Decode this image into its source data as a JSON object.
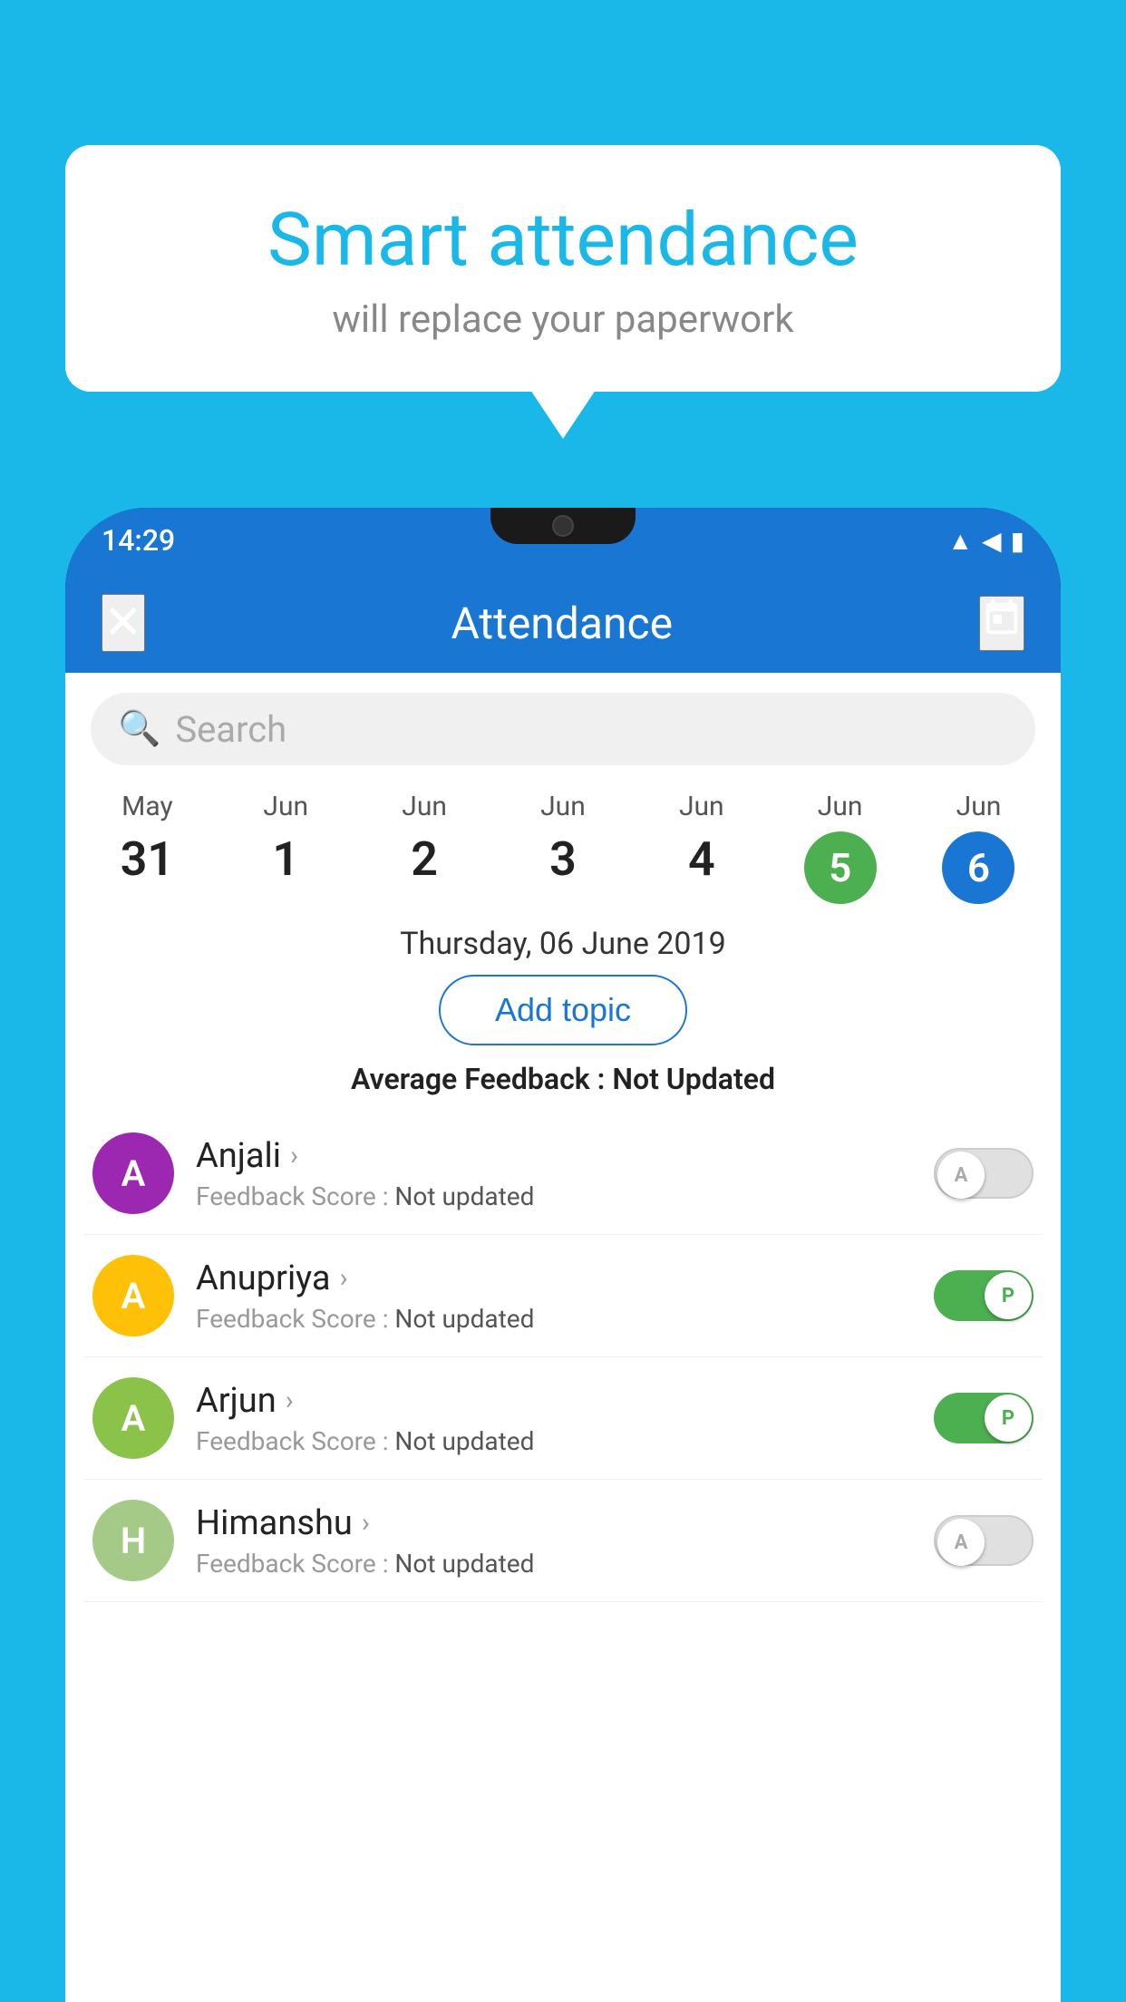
{
  "background_color": "#1ab8e8",
  "bubble": {
    "title": "Smart attendance",
    "subtitle": "will replace your paperwork"
  },
  "status_bar": {
    "time": "14:29",
    "wifi_icon": "▲",
    "signal_icon": "▲",
    "battery_icon": "▮"
  },
  "app_bar": {
    "title": "Attendance",
    "close_label": "×",
    "calendar_icon": "📅"
  },
  "search": {
    "placeholder": "Search"
  },
  "calendar": {
    "days": [
      {
        "month": "May",
        "date": "31",
        "state": "normal"
      },
      {
        "month": "Jun",
        "date": "1",
        "state": "normal"
      },
      {
        "month": "Jun",
        "date": "2",
        "state": "normal"
      },
      {
        "month": "Jun",
        "date": "3",
        "state": "normal"
      },
      {
        "month": "Jun",
        "date": "4",
        "state": "normal"
      },
      {
        "month": "Jun",
        "date": "5",
        "state": "today"
      },
      {
        "month": "Jun",
        "date": "6",
        "state": "selected"
      }
    ]
  },
  "selected_date": "Thursday, 06 June 2019",
  "add_topic_label": "Add topic",
  "avg_feedback_label": "Average Feedback : ",
  "avg_feedback_value": "Not Updated",
  "students": [
    {
      "name": "Anjali",
      "avatar_letter": "A",
      "avatar_color": "#9c27b0",
      "feedback_label": "Feedback Score : ",
      "feedback_value": "Not updated",
      "toggle_state": "off",
      "toggle_letter": "A"
    },
    {
      "name": "Anupriya",
      "avatar_letter": "A",
      "avatar_color": "#ffc107",
      "feedback_label": "Feedback Score : ",
      "feedback_value": "Not updated",
      "toggle_state": "on",
      "toggle_letter": "P"
    },
    {
      "name": "Arjun",
      "avatar_letter": "A",
      "avatar_color": "#8bc34a",
      "feedback_label": "Feedback Score : ",
      "feedback_value": "Not updated",
      "toggle_state": "on",
      "toggle_letter": "P"
    },
    {
      "name": "Himanshu",
      "avatar_letter": "H",
      "avatar_color": "#a5c986",
      "feedback_label": "Feedback Score : ",
      "feedback_value": "Not updated",
      "toggle_state": "off",
      "toggle_letter": "A"
    }
  ]
}
